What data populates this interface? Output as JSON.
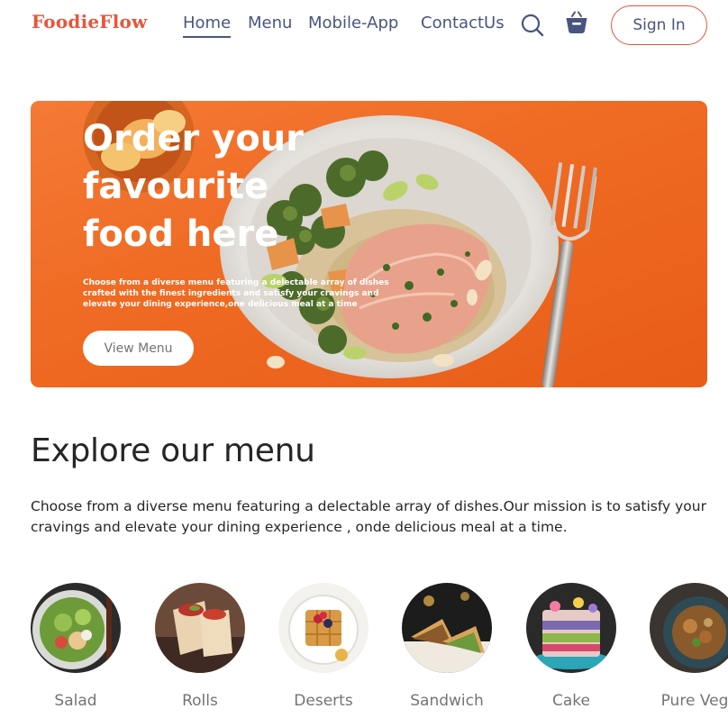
{
  "brand": {
    "logo": "FoodieFlow"
  },
  "nav": {
    "links": [
      "Home",
      "Menu",
      "Mobile-App",
      "ContactUs"
    ],
    "active": "Home",
    "search_icon": "search-icon",
    "basket_icon": "basket-icon",
    "signin_label": "Sign In"
  },
  "hero": {
    "title": "Order your favourite food here",
    "description": "Choose from a diverse menu featuring a delectable array of dishes crafted with the finest ingredients and satisfy your cravings and elevate your dining experience,one delicious meal at a time",
    "button_label": "View Menu"
  },
  "explore": {
    "title": "Explore our menu",
    "text": "Choose from a diverse menu featuring a delectable array of dishes.Our mission is to satisfy your cravings and elevate your dining experience , onde delicious meal at a time."
  },
  "menu_items": [
    {
      "label": "Salad"
    },
    {
      "label": "Rolls"
    },
    {
      "label": "Deserts"
    },
    {
      "label": "Sandwich"
    },
    {
      "label": "Cake"
    },
    {
      "label": "Pure Veg"
    }
  ],
  "colors": {
    "accent": "#e8553c",
    "nav_text": "#49557e",
    "hero_bg": "#ef6a22",
    "muted": "#747474"
  }
}
